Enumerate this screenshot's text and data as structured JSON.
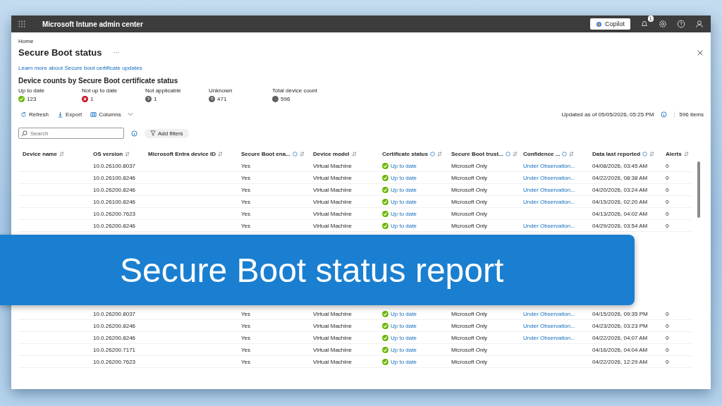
{
  "top_bar": {
    "title": "Microsoft Intune admin center",
    "copilot": "Copilot",
    "notification_count": "1"
  },
  "breadcrumb": "Home",
  "page_title": "Secure Boot status",
  "learn_more": "Learn more about Secure boot certificate updates",
  "section_title": "Device counts by Secure Boot certificate status",
  "counts": [
    {
      "label": "Up to date",
      "value": "123",
      "kind": "ok"
    },
    {
      "label": "Not up to date",
      "value": "1",
      "kind": "error"
    },
    {
      "label": "Not applicable",
      "value": "1",
      "kind": "unknown"
    },
    {
      "label": "Unknown",
      "value": "471",
      "kind": "unknown"
    },
    {
      "label": "Total device count",
      "value": "596",
      "kind": "total"
    }
  ],
  "toolbar": [
    {
      "label": "Refresh",
      "kind": "refresh"
    },
    {
      "label": "Export",
      "kind": "export"
    },
    {
      "label": "Columns",
      "kind": "columns"
    }
  ],
  "updated": "Updated as of 05/05/2026, 05:25 PM",
  "item_count": "596 items",
  "search": {
    "placeholder": "Search"
  },
  "add_filters": "Add filters",
  "columns": [
    {
      "label": "Device name",
      "info": false
    },
    {
      "label": "OS version",
      "info": false
    },
    {
      "label": "Microsoft Entra device ID",
      "info": false
    },
    {
      "label": "Secure Boot ena...",
      "info": true
    },
    {
      "label": "Device model",
      "info": false
    },
    {
      "label": "Certificate status",
      "info": true
    },
    {
      "label": "Secure Boot trust...",
      "info": true
    },
    {
      "label": "Confidence ...",
      "info": true
    },
    {
      "label": "Data last reported",
      "info": true
    },
    {
      "label": "Alerts",
      "info": false
    }
  ],
  "rows_above": [
    {
      "os": "10.0.26100.8037",
      "enabled": "Yes",
      "model": "Virtual Machine",
      "cert": "Up to date",
      "trust": "Microsoft Only",
      "confidence": "Under Observation...",
      "reported": "04/08/2026, 03:45 AM",
      "alerts": "0"
    },
    {
      "os": "10.0.26100.8246",
      "enabled": "Yes",
      "model": "Virtual Machine",
      "cert": "Up to date",
      "trust": "Microsoft Only",
      "confidence": "Under Observation...",
      "reported": "04/22/2026, 08:38 AM",
      "alerts": "0"
    },
    {
      "os": "10.0.26200.8246",
      "enabled": "Yes",
      "model": "Virtual Machine",
      "cert": "Up to date",
      "trust": "Microsoft Only",
      "confidence": "Under Observation...",
      "reported": "04/20/2026, 03:24 AM",
      "alerts": "0"
    },
    {
      "os": "10.0.26100.8246",
      "enabled": "Yes",
      "model": "Virtual Machine",
      "cert": "Up to date",
      "trust": "Microsoft Only",
      "confidence": "Under Observation...",
      "reported": "04/15/2026, 02:20 AM",
      "alerts": "0"
    },
    {
      "os": "10.0.26200.7623",
      "enabled": "Yes",
      "model": "Virtual Machine",
      "cert": "Up to date",
      "trust": "Microsoft Only",
      "reported": "04/13/2026, 04:02 AM",
      "alerts": "0"
    },
    {
      "os": "10.0.26200.8246",
      "enabled": "Yes",
      "model": "Virtual Machine",
      "cert": "Up to date",
      "trust": "Microsoft Only",
      "confidence": "Under Observation...",
      "reported": "04/29/2026, 03:54 AM",
      "alerts": "0"
    }
  ],
  "rows_below": [
    {
      "os": "10.0.26200.8037",
      "enabled": "Yes",
      "model": "Virtual Machine",
      "cert": "Up to date",
      "trust": "Microsoft Only",
      "confidence": "Under Observation...",
      "reported": "04/15/2026, 09:35 PM",
      "alerts": "0"
    },
    {
      "os": "10.0.26200.8246",
      "enabled": "Yes",
      "model": "Virtual Machine",
      "cert": "Up to date",
      "trust": "Microsoft Only",
      "confidence": "Under Observation...",
      "reported": "04/23/2026, 03:23 PM",
      "alerts": "0"
    },
    {
      "os": "10.0.26200.8246",
      "enabled": "Yes",
      "model": "Virtual Machine",
      "cert": "Up to date",
      "trust": "Microsoft Only",
      "confidence": "Under Observation...",
      "reported": "04/22/2026, 04:07 AM",
      "alerts": "0"
    },
    {
      "os": "10.0.26200.7171",
      "enabled": "Yes",
      "model": "Virtual Machine",
      "cert": "Up to date",
      "trust": "Microsoft Only",
      "reported": "04/16/2026, 04:04 AM",
      "alerts": "0"
    },
    {
      "os": "10.0.26200.7623",
      "enabled": "Yes",
      "model": "Virtual Machine",
      "cert": "Up to date",
      "trust": "Microsoft Only",
      "reported": "04/22/2026, 12:29 AM",
      "alerts": "0"
    }
  ],
  "banner": "Secure Boot status report"
}
